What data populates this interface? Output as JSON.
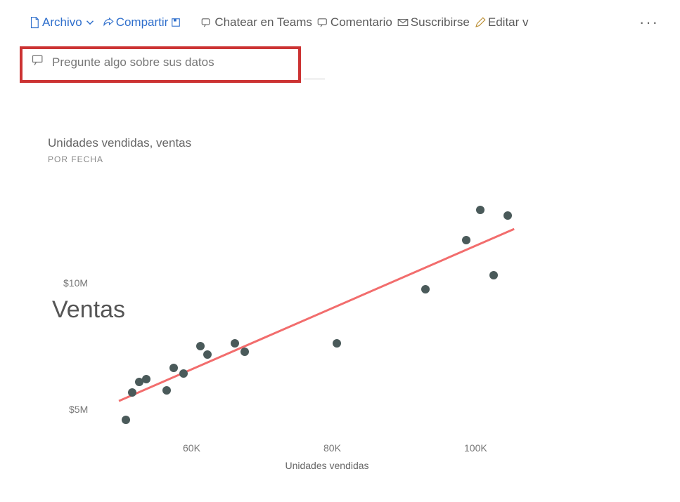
{
  "toolbar": {
    "file": "Archivo",
    "share": "Compartir",
    "teams": "Chatear en Teams",
    "comment": "Comentario",
    "subscribe": "Suscribirse",
    "edit": "Editar v",
    "more": "···"
  },
  "qna": {
    "placeholder": "Pregunte algo sobre sus datos"
  },
  "chart": {
    "title": "Unidades vendidas, ventas",
    "subtitle": "POR FECHA",
    "ylabel_overlay": "Ventas",
    "x_axis_label": "Unidades vendidas",
    "y_ticks": {
      "t10": "$10M",
      "t5": "$5M"
    },
    "x_ticks": {
      "t60": "60K",
      "t80": "80K",
      "t100": "100K"
    }
  },
  "chart_data": {
    "type": "scatter",
    "title": "Unidades vendidas, ventas",
    "subtitle": "POR FECHA",
    "xlabel": "Unidades vendidas",
    "ylabel": "Ventas",
    "xlim": [
      45000,
      110000
    ],
    "ylim": [
      4000000,
      13000000
    ],
    "series": [
      {
        "name": "Ventas",
        "points": [
          {
            "x": 49000,
            "y": 4300000
          },
          {
            "x": 50000,
            "y": 5300000
          },
          {
            "x": 51000,
            "y": 5700000
          },
          {
            "x": 52000,
            "y": 5800000
          },
          {
            "x": 55000,
            "y": 5400000
          },
          {
            "x": 56000,
            "y": 6200000
          },
          {
            "x": 57500,
            "y": 6000000
          },
          {
            "x": 60000,
            "y": 7000000
          },
          {
            "x": 61000,
            "y": 6700000
          },
          {
            "x": 65000,
            "y": 7100000
          },
          {
            "x": 66500,
            "y": 6800000
          },
          {
            "x": 80000,
            "y": 7100000
          },
          {
            "x": 93000,
            "y": 9100000
          },
          {
            "x": 99000,
            "y": 10900000
          },
          {
            "x": 101000,
            "y": 12000000
          },
          {
            "x": 103000,
            "y": 9600000
          },
          {
            "x": 105000,
            "y": 11800000
          }
        ]
      }
    ],
    "trendline": {
      "x1": 48000,
      "y1": 5000000,
      "x2": 106000,
      "y2": 11300000
    }
  }
}
